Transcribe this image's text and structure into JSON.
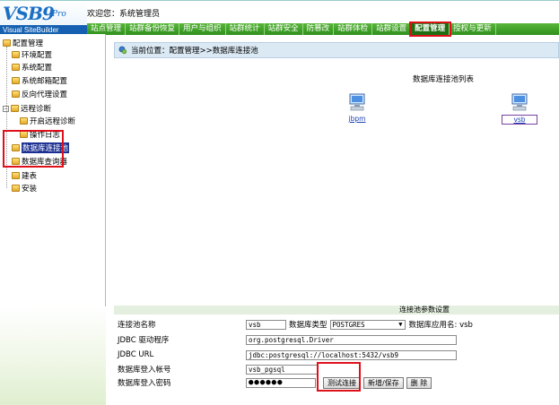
{
  "header": {
    "logo_main": "VSB9",
    "logo_pro": "Pro",
    "logo_sub": "Visual SiteBuilder",
    "welcome": "欢迎您：系统管理员"
  },
  "nav": {
    "items": [
      "站点管理",
      "站群备份恢复",
      "用户与组织",
      "站群统计",
      "站群安全",
      "防篡改",
      "站群体检",
      "站群设置",
      "配置管理",
      "授权与更新"
    ],
    "active_index": 8
  },
  "sidebar": {
    "items": [
      {
        "label": "配置管理"
      },
      {
        "label": "环境配置"
      },
      {
        "label": "系统配置"
      },
      {
        "label": "系统邮箱配置"
      },
      {
        "label": "反向代理设置"
      },
      {
        "label": "远程诊断"
      },
      {
        "label": "开启远程诊断"
      },
      {
        "label": "操作日志"
      },
      {
        "label": "数据库连接池"
      },
      {
        "label": "数据库查询器"
      },
      {
        "label": "建表"
      },
      {
        "label": "安装"
      }
    ]
  },
  "breadcrumb": {
    "text": "当前位置：配置管理>>数据库连接池"
  },
  "pool": {
    "title": "数据库连接池列表",
    "items": [
      "jbpm",
      "vsb"
    ]
  },
  "settings": {
    "header": "连接池参数设置",
    "pool_name_label": "连接池名称",
    "pool_name_value": "vsb",
    "db_type_label": "数据库类型",
    "db_type_value": "POSTGRES",
    "app_name_label": "数据库应用名: vsb",
    "jdbc_driver_label": "JDBC 驱动程序",
    "jdbc_driver_value": "org.postgresql.Driver",
    "jdbc_url_label": "JDBC URL",
    "jdbc_url_value": "jdbc:postgresql://localhost:5432/vsb9",
    "login_account_label": "数据库登入帐号",
    "login_account_value": "vsb_pgsql",
    "login_password_label": "数据库登入密码",
    "login_password_value": "●●●●●●",
    "test_button": "测试连接",
    "save_button": "新增/保存",
    "delete_button": "删 除"
  },
  "colors": {
    "nav_green": "#3f9f27",
    "highlight_blue": "#1c2f92",
    "annotation_red": "#e0101b"
  }
}
